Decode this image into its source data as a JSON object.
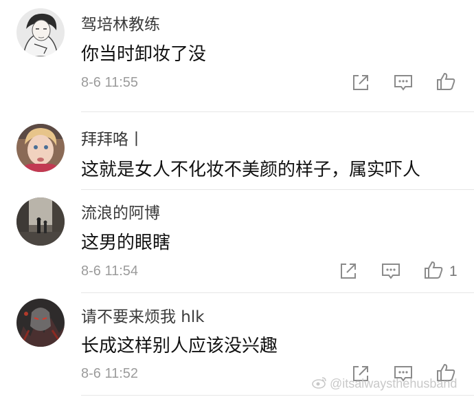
{
  "comments": [
    {
      "username": "驾培林教练",
      "text": "你当时卸妆了没",
      "time": "8-6 11:55",
      "likes": ""
    },
    {
      "username": "拜拜咯丨",
      "text": "这就是女人不化妆不美颜的样子，属实吓人",
      "time": "",
      "likes": ""
    },
    {
      "username": "流浪的阿博",
      "text": "这男的眼瞎",
      "time": "8-6 11:54",
      "likes": "1"
    },
    {
      "username": "请不要来烦我 hlk",
      "text": "长成这样别人应该没兴趣",
      "time": "8-6 11:52",
      "likes": ""
    }
  ],
  "icons": {
    "share": "share-icon",
    "reply": "comment-reply-icon",
    "like": "thumbs-up-icon"
  },
  "watermark": "@itsalwaysthehusband",
  "colors": {
    "text": "#111111",
    "username": "#3a3a3a",
    "meta": "#9b9b9b",
    "icon": "#8a8a8a",
    "divider": "#e6e6e6"
  }
}
